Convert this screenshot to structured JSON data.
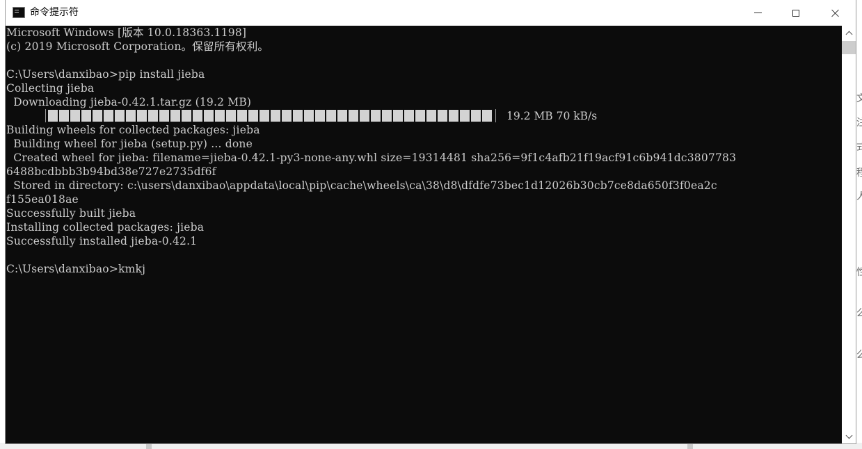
{
  "window": {
    "title": "命令提示符",
    "controls": {
      "minimize": "minimize",
      "maximize": "maximize",
      "close": "close"
    }
  },
  "console": {
    "lines": [
      "Microsoft Windows [版本 10.0.18363.1198]",
      "(c) 2019 Microsoft Corporation。保留所有权利。",
      "",
      "C:\\Users\\danxibao>pip install jieba",
      "Collecting jieba",
      "  Downloading jieba-0.42.1.tar.gz (19.2 MB)",
      "",
      "Building wheels for collected packages: jieba",
      "  Building wheel for jieba (setup.py) ... done",
      "  Created wheel for jieba: filename=jieba-0.42.1-py3-none-any.whl size=19314481 sha256=9f1c4afb21f19acf91c6b941dc3807783",
      "6488bcdbbb3b94bd38e727e2735df6f",
      "  Stored in directory: c:\\users\\danxibao\\appdata\\local\\pip\\cache\\wheels\\ca\\38\\d8\\dfdfe73bec1d12026b30cb7ce8da650f3f0ea2c",
      "f155ea018ae",
      "Successfully built jieba",
      "Installing collected packages: jieba",
      "Successfully installed jieba-0.42.1",
      "",
      "C:\\Users\\danxibao>kmkj"
    ],
    "progress": {
      "fraction": 1.0,
      "text": "19.2 MB 70 kB/s"
    }
  },
  "background_app": {
    "right_edge_glyphs": [
      "文",
      "注",
      "式",
      "程",
      "人",
      "性",
      "么",
      "么"
    ]
  },
  "colors": {
    "console_bg": "#0c0c0c",
    "console_fg": "#cccccc",
    "titlebar_bg": "#ffffff",
    "progress_fill": "#d3d3d3"
  }
}
